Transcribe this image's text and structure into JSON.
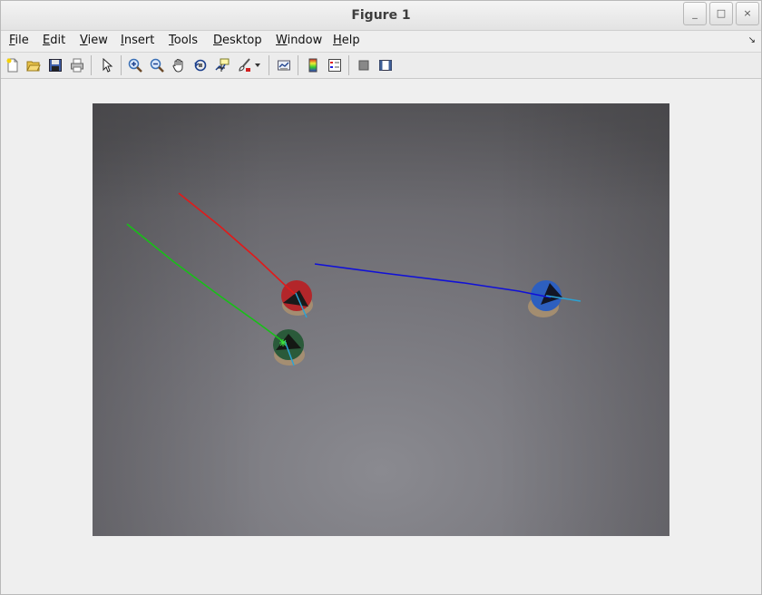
{
  "window": {
    "title": "Figure 1",
    "controls": {
      "minimize": "_",
      "maximize": "□",
      "close": "×"
    }
  },
  "menubar": {
    "items": [
      {
        "key": "F",
        "rest": "ile"
      },
      {
        "key": "E",
        "rest": "dit"
      },
      {
        "key": "V",
        "rest": "iew"
      },
      {
        "key": "I",
        "rest": "nsert"
      },
      {
        "key": "T",
        "rest": "ools"
      },
      {
        "key": "D",
        "rest": "esktop"
      },
      {
        "key": "W",
        "rest": "indow"
      },
      {
        "key": "H",
        "rest": "elp"
      }
    ],
    "overflow_arrow": "↘"
  },
  "toolbar": {
    "icons": [
      "new-figure-icon",
      "open-file-icon",
      "save-icon",
      "print-icon",
      "pointer-arrow-icon",
      "zoom-in-icon",
      "zoom-out-icon",
      "pan-hand-icon",
      "rotate-3d-icon",
      "data-cursor-icon",
      "brush-icon",
      "dropdown-arrow-icon",
      "link-plot-icon",
      "colorbar-icon",
      "legend-icon",
      "hide-plot-tools-icon",
      "show-plot-tools-icon"
    ]
  },
  "image": {
    "description_colors": {
      "background": "#6c6b70",
      "red_line": "#e11a1a",
      "green_line": "#17c017",
      "blue_line": "#1010d8",
      "cyan_line": "#2aa3d6"
    },
    "objects": [
      "red-robot",
      "green-robot",
      "blue-robot"
    ]
  }
}
